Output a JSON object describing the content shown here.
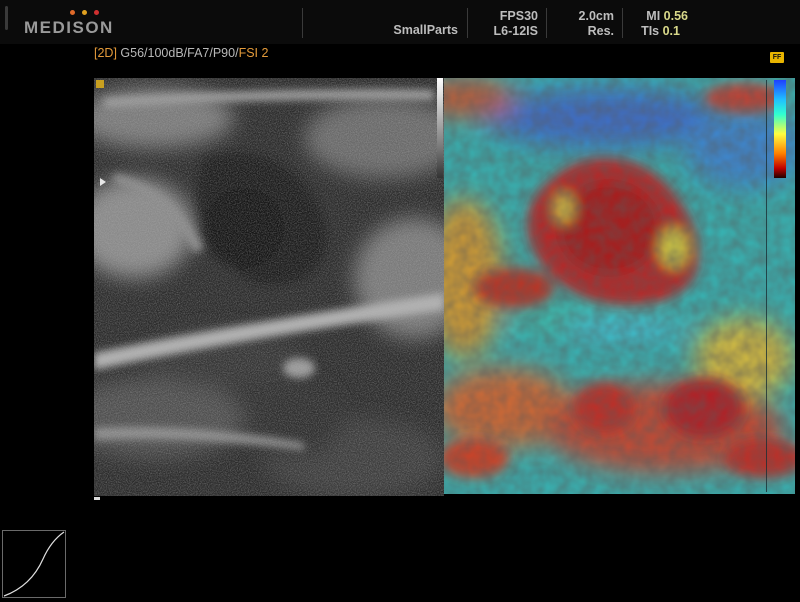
{
  "brand": {
    "name": "MEDISON",
    "dot_colors": [
      "#e06a2a",
      "#e0a020",
      "#d03030"
    ]
  },
  "status_bar": {
    "preset": "SmallParts",
    "fps": "FPS30",
    "probe": "L6-12IS",
    "depth": "2.0cm",
    "res": "Res.",
    "mi_label": "MI",
    "mi_value": "0.56",
    "tis_label": "TIs",
    "tis_value": "0.1"
  },
  "params_line": {
    "mode": "[2D]",
    "settings": " G56/100dB/FA7/P90/",
    "fsi": "FSI 2"
  },
  "badge": {
    "label": "FF"
  },
  "colors": {
    "accent_orange": "#e39a3a",
    "value_yellow": "#d9d98a",
    "background": "#000000"
  }
}
